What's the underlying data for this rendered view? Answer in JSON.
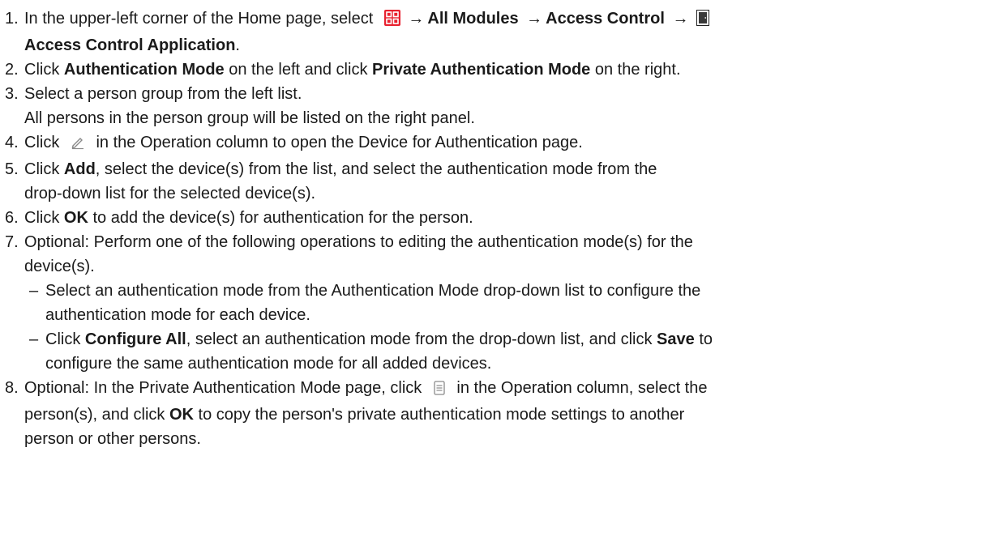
{
  "steps": [
    {
      "num": "1.",
      "t1": "In the upper-left corner of the Home page, select",
      "arrow": "→",
      "b1": "All Modules",
      "b2": "Access Control",
      "b3": "Access Control Application",
      "end": ".",
      "grid_icon": "app-grid-icon",
      "grid_icon_color": "#e8212f",
      "door_icon": "door-icon"
    },
    {
      "num": "2.",
      "t1": "Click",
      "b1": "Authentication Mode",
      "t2": "on the left and click",
      "b2": "Private Authentication Mode",
      "t3": "on the right."
    },
    {
      "num": "3.",
      "t1": "Select a person group from the left list.",
      "t2": "All persons in the person group will be listed on the right panel."
    },
    {
      "num": "4.",
      "t1": "Click",
      "t2": "in the Operation column to open the Device for Authentication page.",
      "icon": "edit-icon"
    },
    {
      "num": "5.",
      "t1": "Click",
      "b1": "Add",
      "t2": ", select the device(s) from the list, and select the authentication mode from the",
      "t3": "drop-down list for the selected device(s)."
    },
    {
      "num": "6.",
      "t1": "Click",
      "b1": "OK",
      "t2": "to add the device(s) for authentication for the person."
    },
    {
      "num": "7.",
      "t1": "Optional: Perform one of the following operations to editing the authentication mode(s) for the",
      "t2": "device(s).",
      "subs": [
        {
          "dash": "–",
          "l1": "Select an authentication mode from the Authentication Mode drop-down list to configure the",
          "l2": "authentication mode for each device."
        },
        {
          "dash": "–",
          "t1": "Click",
          "b1": "Configure All",
          "t2": ", select an authentication mode from the drop-down list, and click",
          "b2": "Save",
          "t3": "to",
          "l2": "configure the same authentication mode for all added devices."
        }
      ]
    },
    {
      "num": "8.",
      "t1": "Optional: In the Private Authentication Mode page, click",
      "t2": "in the Operation column, select the",
      "t3": "person(s), and click",
      "b1": "OK",
      "t4": "to copy the person's private authentication mode settings to another",
      "t5": "person or other persons.",
      "icon": "copy-icon"
    }
  ]
}
